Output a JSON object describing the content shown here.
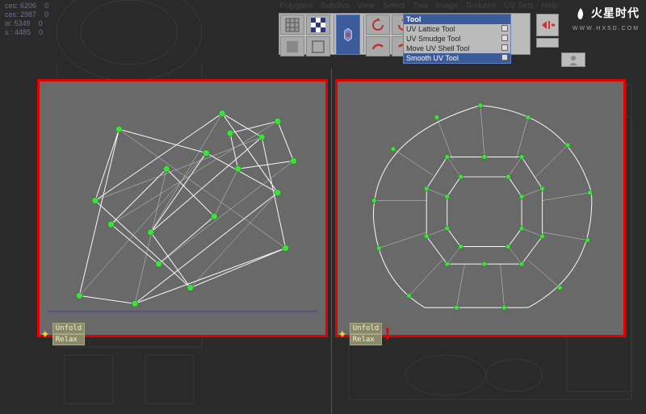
{
  "stats": {
    "l1_label": "ces:",
    "l1_val": "6206",
    "l1_sel": "0",
    "l2_label": "ces:",
    "l2_val": "2987",
    "l2_sel": "0",
    "l3_label": "is:",
    "l3_val": "5349",
    "l3_sel": "0",
    "l4_label": "s :",
    "l4_val": "4485",
    "l4_sel": "0"
  },
  "menu": {
    "items": [
      "Polygons",
      "Subdivs",
      "View",
      "Select",
      "Tool",
      "Image",
      "Textures",
      "UV Sets",
      "Help"
    ]
  },
  "toolmenu": {
    "header": "Tool",
    "items": [
      {
        "label": "UV Lattice Tool",
        "sel": false
      },
      {
        "label": "UV Smudge Tool",
        "sel": false
      },
      {
        "label": "Move UV Shell Tool",
        "sel": false
      },
      {
        "label": "Smooth UV Tool",
        "sel": true
      }
    ]
  },
  "labels": {
    "unfold": "Unfold",
    "relax": "Relax"
  },
  "logo": {
    "cn": "火星时代",
    "en": "WWW.HXSD.COM"
  }
}
